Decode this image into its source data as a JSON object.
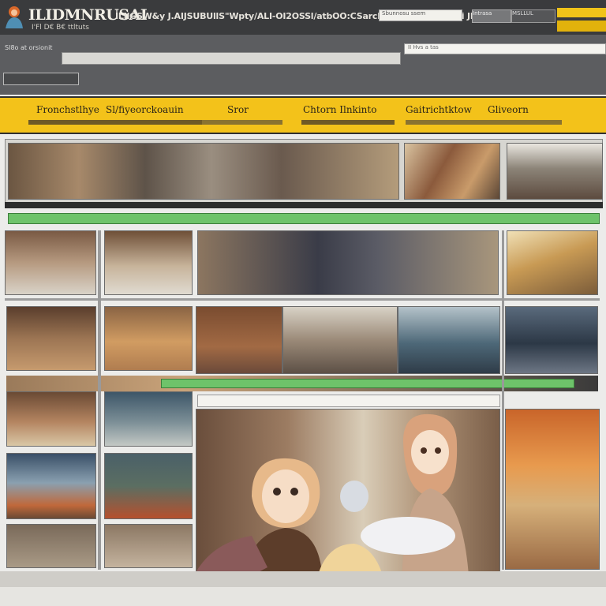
{
  "header": {
    "app_title": "ILIDMNRUSAI",
    "app_subtitle": "I'Fl D€ B€ ttltuts",
    "menu_text": "ILIlGSW&y J.AIJSUBUllS\"Wpty/ALI-OI2OSSl/atbOO:CSarchdoci PorAStNaroi JLIOWP",
    "search_placeholder": "Sbunnosu ssem",
    "button1_label": "Intrasa",
    "button2_label": "MSLLUL"
  },
  "toolbar": {
    "left_label": "SI8o at orsionit",
    "right_field_value": "II Hvs a tas"
  },
  "nav": {
    "items": [
      {
        "label": "Fronchstlhye"
      },
      {
        "label": "Sl/fiyeorckoauin"
      },
      {
        "label": "Sror"
      },
      {
        "label": "Chtorn Ilnkinto"
      },
      {
        "label": "Gaitrichtktow"
      },
      {
        "label": "Gliveorn"
      }
    ]
  },
  "colors": {
    "header_bg": "#3a3b3d",
    "nav_yellow": "#f3c21a",
    "divider_green": "#6ec36a",
    "page_bg": "#ececea"
  }
}
